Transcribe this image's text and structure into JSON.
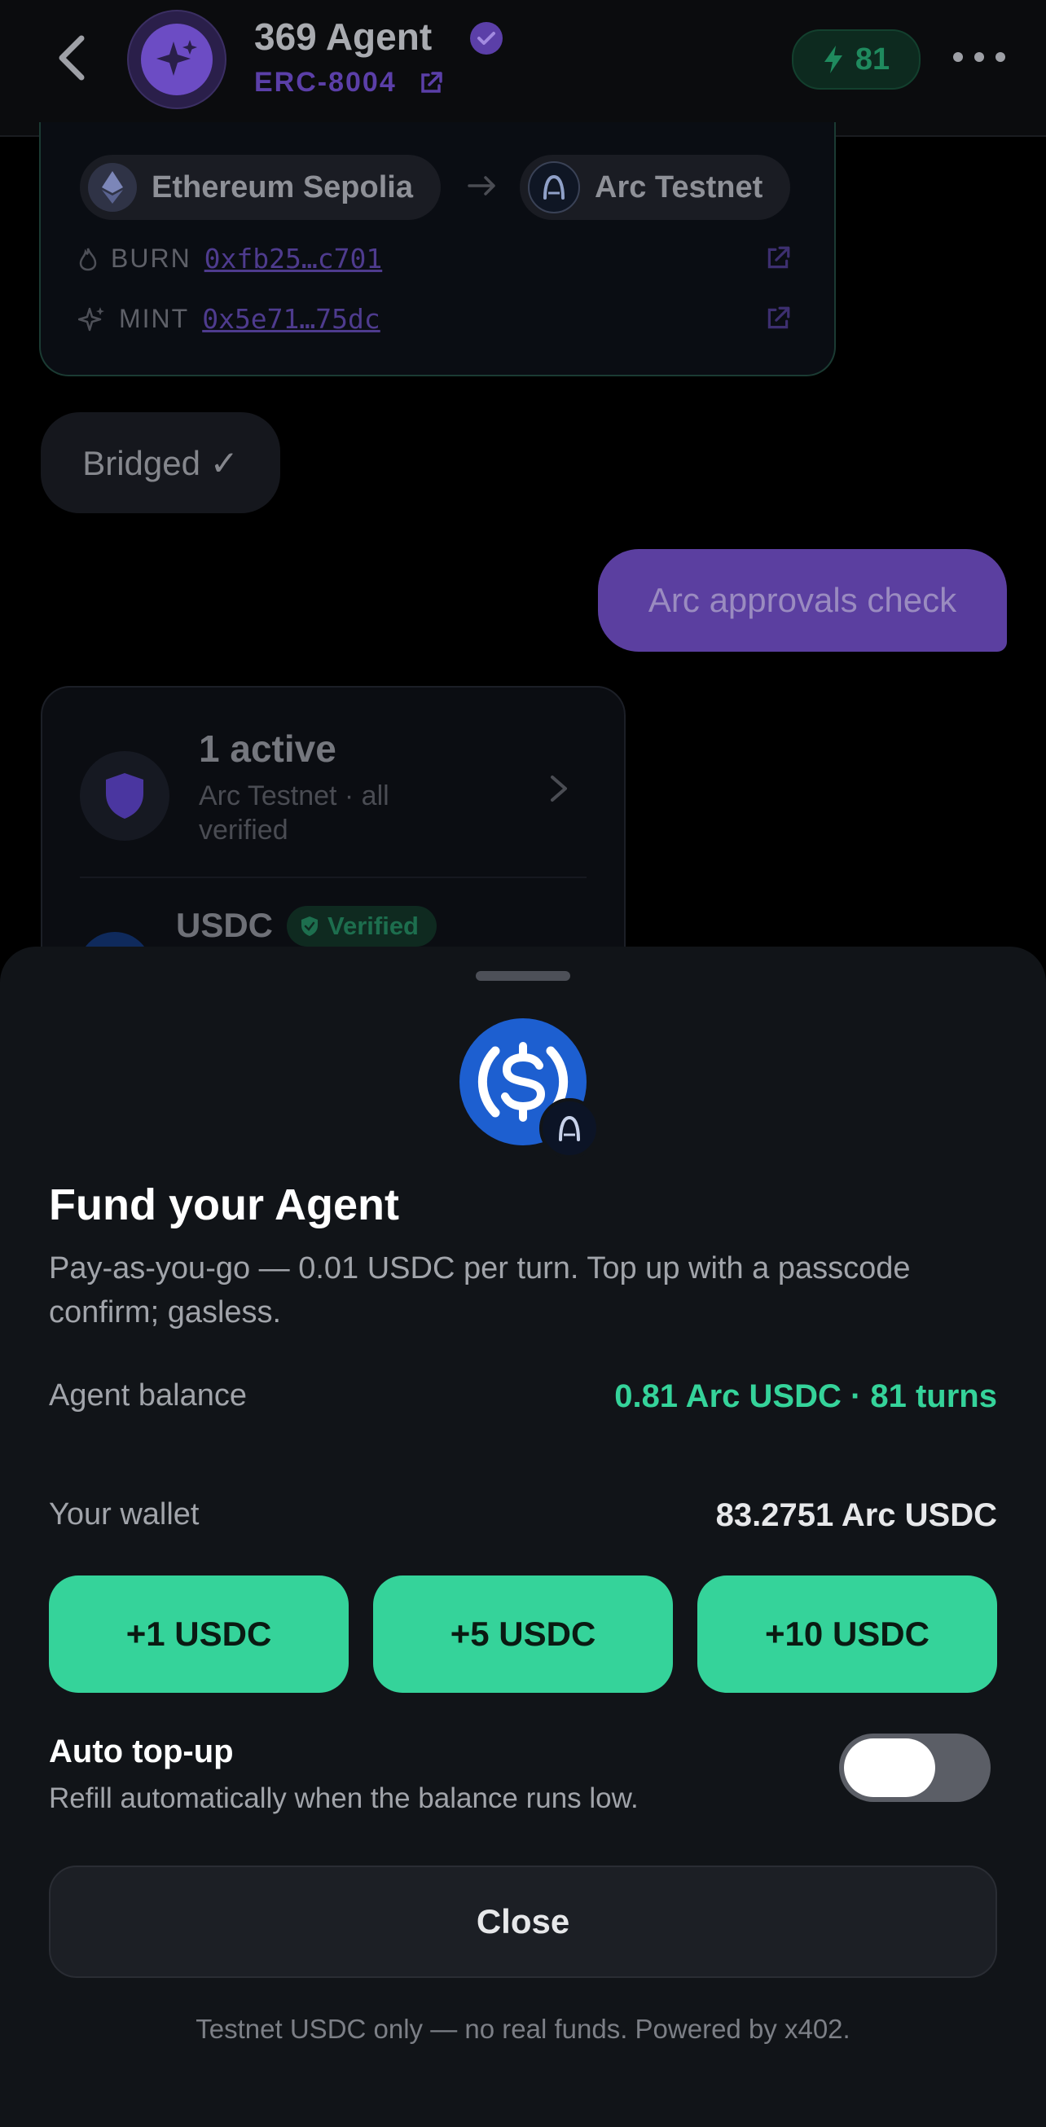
{
  "header": {
    "agent_name": "369 Agent",
    "standard": "ERC-8004",
    "energy": "81"
  },
  "bridge": {
    "from_chain": "Ethereum Sepolia",
    "to_chain": "Arc Testnet",
    "burn_label": "BURN",
    "burn_hash": "0xfb25…c701",
    "mint_label": "MINT",
    "mint_hash": "0x5e71…75dc"
  },
  "chat": {
    "bot_message": "Bridged ✓",
    "user_message": "Arc approvals check"
  },
  "approvals": {
    "title": "1 active",
    "subtitle": "Arc Testnet · all verified",
    "token": "USDC",
    "badge": "Verified"
  },
  "sheet": {
    "title": "Fund your Agent",
    "description": "Pay-as-you-go — 0.01 USDC per turn. Top up with a passcode confirm; gasless.",
    "agent_balance_label": "Agent balance",
    "agent_balance_value": "0.81 Arc USDC · 81 turns",
    "wallet_label": "Your wallet",
    "wallet_value": "83.2751 Arc USDC",
    "topup_options": [
      "+1 USDC",
      "+5 USDC",
      "+10 USDC"
    ],
    "auto_topup_title": "Auto top-up",
    "auto_topup_desc": "Refill automatically when the balance runs low.",
    "auto_topup_enabled": false,
    "close_label": "Close",
    "footer": "Testnet USDC only — no real funds. Powered by x402."
  },
  "colors": {
    "accent_green": "#35d39a",
    "accent_purple": "#6c4cc4",
    "usdc_blue": "#1d5fd0",
    "sheet_bg": "#111418"
  },
  "icons": [
    "back-chevron-icon",
    "sparkle-icon",
    "verified-check-icon",
    "external-link-icon",
    "bolt-icon",
    "more-dots-icon",
    "ethereum-icon",
    "arc-icon",
    "arrow-right-icon",
    "flame-icon",
    "sparkle-mint-icon",
    "shield-icon",
    "chevron-right-icon",
    "usdc-coin-icon"
  ]
}
